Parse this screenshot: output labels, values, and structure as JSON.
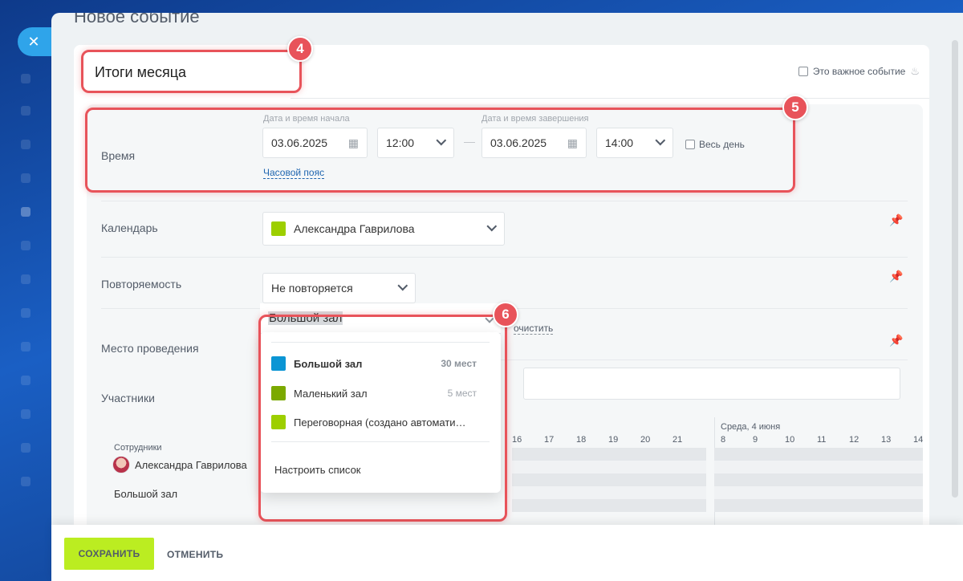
{
  "window": {
    "title": "Новое событие",
    "close_icon": "close-icon"
  },
  "event": {
    "name": "Итоги месяца",
    "important_label": "Это важное событие",
    "important_checked": false
  },
  "time": {
    "label": "Время",
    "start_caption": "Дата и время начала",
    "end_caption": "Дата и время завершения",
    "start_date": "03.06.2025",
    "start_time": "12:00",
    "end_date": "03.06.2025",
    "end_time": "14:00",
    "separator": "—",
    "all_day_label": "Весь день",
    "timezone_link": "Часовой пояс"
  },
  "calendar": {
    "label": "Календарь",
    "value": "Александра Гаврилова",
    "color": "#9dcf00"
  },
  "repeat": {
    "label": "Повторяемость",
    "value": "Не повторяется"
  },
  "location": {
    "label": "Место проведения",
    "value": "Большой зал",
    "clear_link": "очистить",
    "options": [
      {
        "name": "Большой зал",
        "capacity": "30 мест",
        "color": "#0b95d4",
        "selected": true
      },
      {
        "name": "Маленький зал",
        "capacity": "5 мест",
        "color": "#7ba900",
        "selected": false
      },
      {
        "name": "Переговорная (создано автомати…",
        "capacity": "",
        "color": "#9dcf00",
        "selected": false
      }
    ],
    "configure_label": "Настроить список"
  },
  "participants": {
    "label": "Участники"
  },
  "schedule": {
    "employees_caption": "Сотрудники",
    "employee_name": "Александра Гаврилова",
    "room_name": "Большой зал",
    "day_label": "Среда, 4 июня",
    "hours_day1": [
      "16",
      "17",
      "18",
      "19",
      "20",
      "21"
    ],
    "hours_day2": [
      "8",
      "9",
      "10",
      "11",
      "12",
      "13",
      "14"
    ]
  },
  "annotations": [
    "4",
    "5",
    "6"
  ],
  "footer": {
    "save_label": "СОХРАНИТЬ",
    "cancel_label": "ОТМЕНИТЬ"
  },
  "colors": {
    "accent_red": "#e8535a",
    "save_green": "#bbed21",
    "link_blue": "#2066b0"
  }
}
